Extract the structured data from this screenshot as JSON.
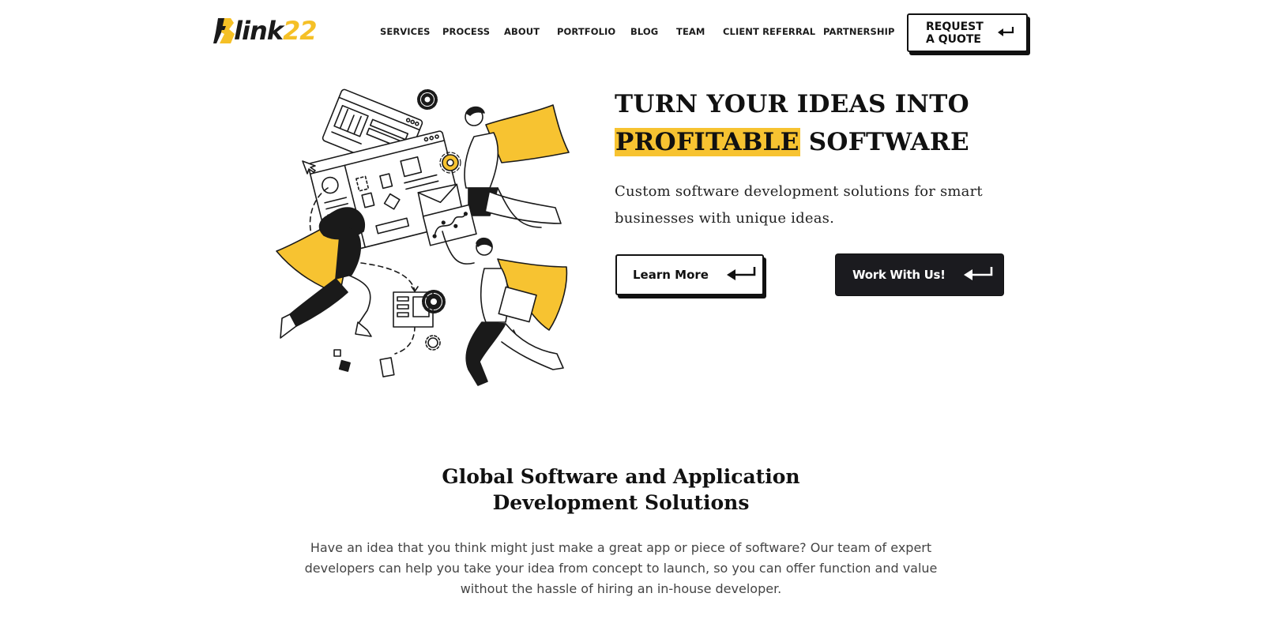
{
  "brand": {
    "logo_main": "link",
    "logo_accent": "22",
    "logo_initial_icon": "bolt-b-icon",
    "accent_color": "#f7c331",
    "dark_color": "#1b1b1f"
  },
  "nav": {
    "items": [
      {
        "label": "SERVICES"
      },
      {
        "label": "PROCESS"
      },
      {
        "label": "ABOUT"
      },
      {
        "label": "PORTFOLIO"
      },
      {
        "label": "BLOG"
      },
      {
        "label": "TEAM"
      },
      {
        "label": "CLIENT REFERRAL"
      },
      {
        "label": "PARTNERSHIP"
      }
    ],
    "cta_line1": "REQUEST",
    "cta_line2": "A QUOTE",
    "cta_icon": "enter-arrow-icon"
  },
  "hero": {
    "title_line1": "TURN YOUR IDEAS INTO",
    "title_highlight": "PROFITABLE",
    "title_rest": " SOFTWARE",
    "subtitle": "Custom software development solutions for smart businesses with unique ideas.",
    "primary_button": "Learn More",
    "secondary_button": "Work With Us!",
    "illustration": "team-of-superheroes-building-software-illustration"
  },
  "section": {
    "title_line1": "Global Software and Application",
    "title_line2": "Development Solutions",
    "body": "Have an idea that you think might just make a great app or piece of software? Our team of expert developers can help you take your idea from concept to launch, so you can offer function and value without the hassle of hiring an in-house developer."
  }
}
